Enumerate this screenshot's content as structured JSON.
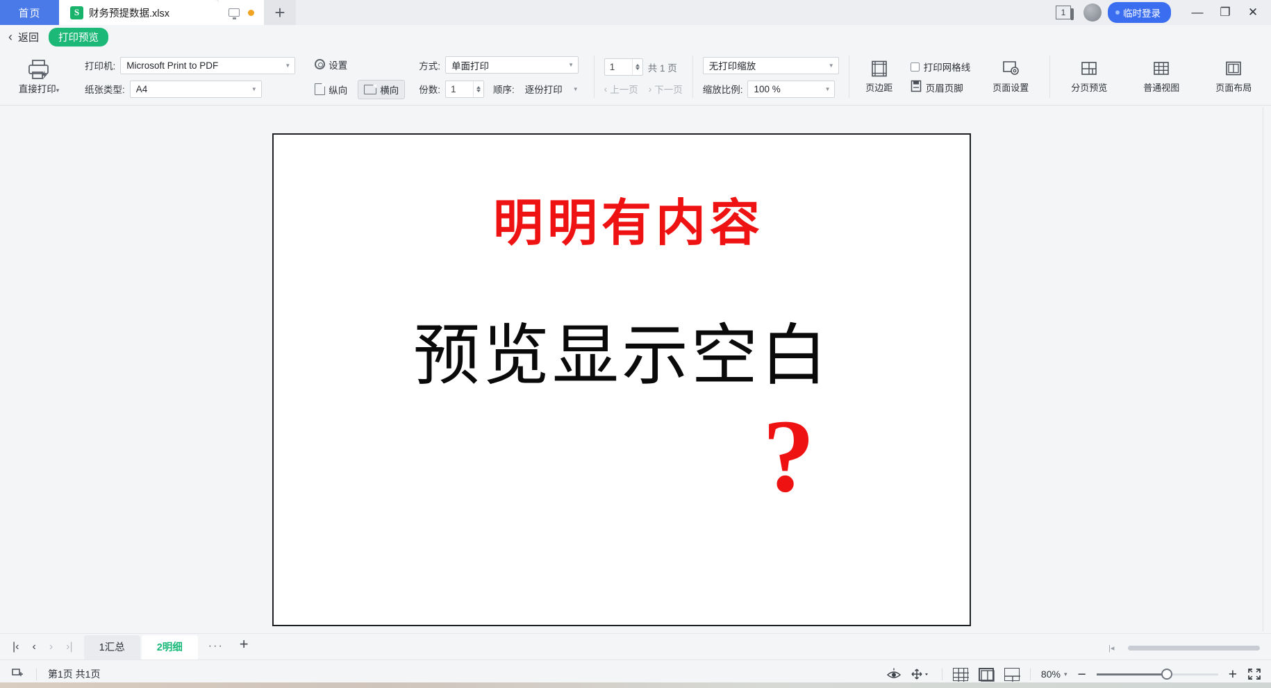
{
  "titlebar": {
    "home_tab": "首页",
    "doc_tab": {
      "icon": "xlsx-file-icon",
      "name": "财务预提数据.xlsx"
    },
    "tab_icons": [
      "monitor-icon",
      "unsaved-dot-icon"
    ],
    "new_tab": "+",
    "window_count": "1",
    "login_label": "临时登录",
    "minimize": "—",
    "restore": "❐",
    "close": "✕"
  },
  "backrow": {
    "chevron": "‹",
    "back_label": "返回",
    "mode_badge": "打印预览"
  },
  "ribbon": {
    "direct_print": {
      "label": "直接打印",
      "carat": "▾"
    },
    "printer": {
      "label": "打印机:",
      "value": "Microsoft Print to PDF"
    },
    "paper": {
      "label": "纸张类型:",
      "value": "A4"
    },
    "settings_button": "设置",
    "orientation": {
      "portrait": "纵向",
      "landscape": "横向",
      "selected": "横向"
    },
    "method": {
      "label": "方式:",
      "value": "单面打印"
    },
    "copies": {
      "label": "份数:",
      "value": "1"
    },
    "order": {
      "label": "顺序:",
      "value": "逐份打印"
    },
    "page_number": {
      "value": "1",
      "total": "共 1 页"
    },
    "prev_page": "上一页",
    "next_page": "下一页",
    "scaling": {
      "value": "无打印缩放"
    },
    "scale_ratio": {
      "label": "缩放比例:",
      "value": "100 %"
    },
    "margins_label": "页边距",
    "gridlines_label": "打印网格线",
    "gridlines_checked": false,
    "header_footer_label": "页眉页脚",
    "page_setup_label": "页面设置",
    "page_break_preview_label": "分页预览",
    "normal_view_label": "普通视图",
    "page_layout_label": "页面布局"
  },
  "preview": {
    "red_title": "明明有内容",
    "black_line": "预览显示空白",
    "question_mark": "?",
    "colors": {
      "red": "#ef1212",
      "black": "#0a0a0a",
      "page_border": "#1e1f22"
    }
  },
  "sheetbar": {
    "nav": {
      "first": "|‹",
      "prev": "‹",
      "next": "›",
      "last": "›|"
    },
    "tabs": [
      {
        "label": "1汇总",
        "active": false
      },
      {
        "label": "2明细",
        "active": true
      }
    ],
    "more": "···",
    "add": "+"
  },
  "statusbar": {
    "icon": "page-break-icon",
    "page_info": "第1页 共1页",
    "eye_icon": "eye-icon",
    "move_icon": "move-icon",
    "move_caret": "▾",
    "views": [
      "normal-view-icon",
      "page-layout-icon",
      "page-break-view-icon"
    ],
    "active_view_index": 1,
    "zoom_label": "80%",
    "zoom_caret": "▾",
    "zoom_out": "−",
    "zoom_in": "+",
    "fullscreen": "fullscreen-icon"
  }
}
